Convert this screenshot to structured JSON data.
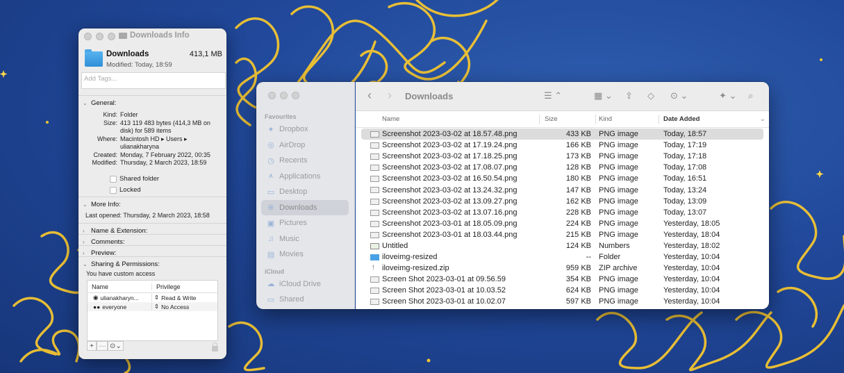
{
  "info_window": {
    "title": "Downloads Info",
    "name": "Downloads",
    "size": "413,1 MB",
    "modified_line": "Modified: Today, 18:59",
    "tags_placeholder": "Add Tags...",
    "general_label": "General:",
    "general": [
      {
        "key": "Kind:",
        "value": "Folder"
      },
      {
        "key": "Size:",
        "value": "413 119 483 bytes (414,3 MB on disk) for 589 items"
      },
      {
        "key": "Where:",
        "value": "Macintosh HD ▸ Users ▸ ulianakharyna"
      },
      {
        "key": "Created:",
        "value": "Monday, 7 February 2022, 00:35"
      },
      {
        "key": "Modified:",
        "value": "Thursday, 2 March 2023, 18:59"
      }
    ],
    "shared_folder_label": "Shared folder",
    "locked_label": "Locked",
    "more_info_label": "More Info:",
    "last_opened": "Last opened: Thursday, 2 March 2023, 18:58",
    "name_extension_label": "Name & Extension:",
    "comments_label": "Comments:",
    "preview_label": "Preview:",
    "sharing_label": "Sharing & Permissions:",
    "custom_access": "You have custom access",
    "perm_headers": {
      "name": "Name",
      "privilege": "Privilege"
    },
    "permissions": [
      {
        "name": "ulianakharyn...",
        "privilege": "Read & Write",
        "icon": "person-icon"
      },
      {
        "name": "everyone",
        "privilege": "No Access",
        "icon": "group-icon"
      }
    ],
    "buttons": {
      "add": "+",
      "remove": "—",
      "action": "⊙⌄"
    }
  },
  "finder": {
    "title": "Downloads",
    "sidebar": {
      "favourites_label": "Favourites",
      "favourites": [
        {
          "label": "Dropbox",
          "icon": "dropbox-icon",
          "glyph": "✦"
        },
        {
          "label": "AirDrop",
          "icon": "airdrop-icon",
          "glyph": "◎"
        },
        {
          "label": "Recents",
          "icon": "clock-icon",
          "glyph": "◷"
        },
        {
          "label": "Applications",
          "icon": "applications-icon",
          "glyph": "⩚"
        },
        {
          "label": "Desktop",
          "icon": "desktop-icon",
          "glyph": "▭"
        },
        {
          "label": "Downloads",
          "icon": "downloads-icon",
          "glyph": "⊕",
          "selected": true
        },
        {
          "label": "Pictures",
          "icon": "pictures-icon",
          "glyph": "▣"
        },
        {
          "label": "Music",
          "icon": "music-icon",
          "glyph": "♫"
        },
        {
          "label": "Movies",
          "icon": "movies-icon",
          "glyph": "▤"
        }
      ],
      "icloud_label": "iCloud",
      "icloud": [
        {
          "label": "iCloud Drive",
          "icon": "cloud-icon",
          "glyph": "☁"
        },
        {
          "label": "Shared",
          "icon": "shared-folder-icon",
          "glyph": "▭"
        }
      ]
    },
    "columns": {
      "name": "Name",
      "size": "Size",
      "kind": "Kind",
      "date": "Date Added"
    },
    "files": [
      {
        "name": "Screenshot 2023-03-02 at 18.57.48.png",
        "size": "433 KB",
        "kind": "PNG image",
        "date": "Today, 18:57",
        "type": "img",
        "selected": true
      },
      {
        "name": "Screenshot 2023-03-02 at 17.19.24.png",
        "size": "166 KB",
        "kind": "PNG image",
        "date": "Today, 17:19",
        "type": "img"
      },
      {
        "name": "Screenshot 2023-03-02 at 17.18.25.png",
        "size": "173 KB",
        "kind": "PNG image",
        "date": "Today, 17:18",
        "type": "img"
      },
      {
        "name": "Screenshot 2023-03-02 at 17.08.07.png",
        "size": "128 KB",
        "kind": "PNG image",
        "date": "Today, 17:08",
        "type": "img"
      },
      {
        "name": "Screenshot 2023-03-02 at 16.50.54.png",
        "size": "180 KB",
        "kind": "PNG image",
        "date": "Today, 16:51",
        "type": "img"
      },
      {
        "name": "Screenshot 2023-03-02 at 13.24.32.png",
        "size": "147 KB",
        "kind": "PNG image",
        "date": "Today, 13:24",
        "type": "img"
      },
      {
        "name": "Screenshot 2023-03-02 at 13.09.27.png",
        "size": "162 KB",
        "kind": "PNG image",
        "date": "Today, 13:09",
        "type": "img"
      },
      {
        "name": "Screenshot 2023-03-02 at 13.07.16.png",
        "size": "228 KB",
        "kind": "PNG image",
        "date": "Today, 13:07",
        "type": "img"
      },
      {
        "name": "Screenshot 2023-03-01 at 18.05.09.png",
        "size": "224 KB",
        "kind": "PNG image",
        "date": "Yesterday, 18:05",
        "type": "img"
      },
      {
        "name": "Screenshot 2023-03-01 at 18.03.44.png",
        "size": "215 KB",
        "kind": "PNG image",
        "date": "Yesterday, 18:04",
        "type": "img"
      },
      {
        "name": "Untitled",
        "size": "124 KB",
        "kind": "Numbers",
        "date": "Yesterday, 18:02",
        "type": "num"
      },
      {
        "name": "iloveimg-resized",
        "size": "--",
        "kind": "Folder",
        "date": "Yesterday, 10:04",
        "type": "folder"
      },
      {
        "name": "iloveimg-resized.zip",
        "size": "959 KB",
        "kind": "ZIP archive",
        "date": "Yesterday, 10:04",
        "type": "zip"
      },
      {
        "name": "Screen Shot 2023-03-01 at 09.56.59",
        "size": "354 KB",
        "kind": "PNG image",
        "date": "Yesterday, 10:04",
        "type": "img"
      },
      {
        "name": "Screen Shot 2023-03-01 at 10.03.52",
        "size": "624 KB",
        "kind": "PNG image",
        "date": "Yesterday, 10:04",
        "type": "img"
      },
      {
        "name": "Screen Shot 2023-03-01 at 10.02.07",
        "size": "597 KB",
        "kind": "PNG image",
        "date": "Yesterday, 10:04",
        "type": "img"
      }
    ]
  }
}
